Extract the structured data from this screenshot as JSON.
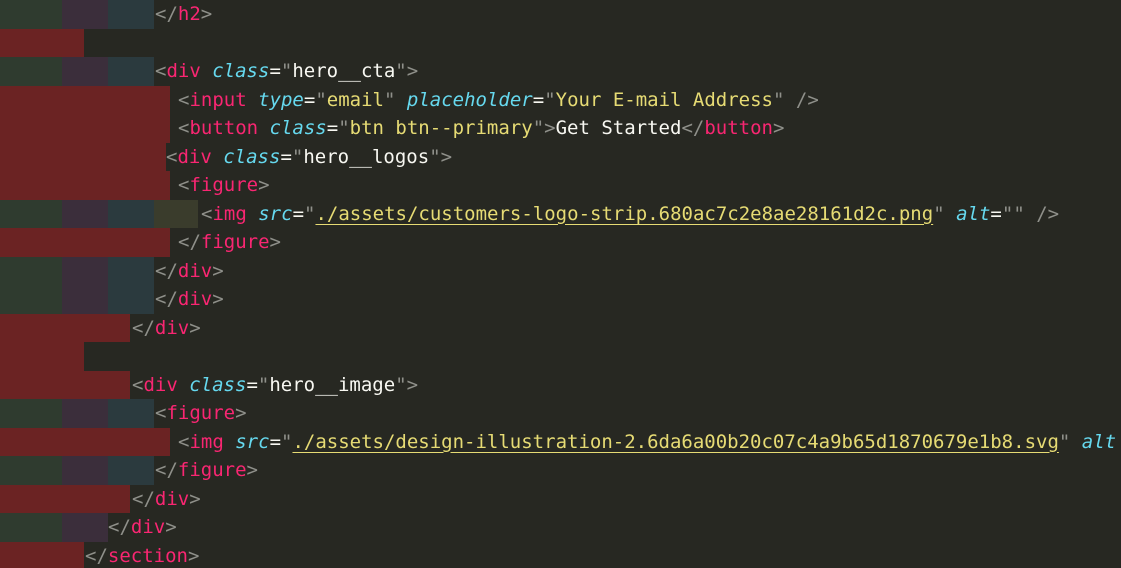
{
  "colors": {
    "background": "#272822",
    "tag": "#f92672",
    "attribute": "#66d9ef",
    "string": "#e6db74",
    "punctuation": "#8f908a",
    "text": "#f8f8f2",
    "indent_red": "#6b2323",
    "indent_green": "#2f3b2f",
    "indent_purple": "#3b2e3b",
    "indent_teal": "#2b3a3e"
  },
  "lines": [
    {
      "tokens": [
        {
          "t": "</",
          "c": "punct"
        },
        {
          "t": "h2",
          "c": "tag"
        },
        {
          "t": ">",
          "c": "punct"
        }
      ]
    },
    {
      "tokens": []
    },
    {
      "tokens": [
        {
          "t": "<",
          "c": "punct"
        },
        {
          "t": "div",
          "c": "tag"
        },
        {
          "t": " ",
          "c": "plain"
        },
        {
          "t": "class",
          "c": "attr"
        },
        {
          "t": "=",
          "c": "eq"
        },
        {
          "t": "\"",
          "c": "punct"
        },
        {
          "t": "hero__cta",
          "c": "plain"
        },
        {
          "t": "\"",
          "c": "punct"
        },
        {
          "t": ">",
          "c": "punct"
        }
      ]
    },
    {
      "tokens": [
        {
          "t": "<",
          "c": "punct"
        },
        {
          "t": "input",
          "c": "tag"
        },
        {
          "t": " ",
          "c": "plain"
        },
        {
          "t": "type",
          "c": "attr"
        },
        {
          "t": "=",
          "c": "eq"
        },
        {
          "t": "\"",
          "c": "punct"
        },
        {
          "t": "email",
          "c": "str"
        },
        {
          "t": "\"",
          "c": "punct"
        },
        {
          "t": " ",
          "c": "plain"
        },
        {
          "t": "placeholder",
          "c": "attr"
        },
        {
          "t": "=",
          "c": "eq"
        },
        {
          "t": "\"",
          "c": "punct"
        },
        {
          "t": "Your E-mail Address",
          "c": "str"
        },
        {
          "t": "\"",
          "c": "punct"
        },
        {
          "t": " />",
          "c": "punct"
        }
      ]
    },
    {
      "tokens": [
        {
          "t": "<",
          "c": "punct"
        },
        {
          "t": "button",
          "c": "tag"
        },
        {
          "t": " ",
          "c": "plain"
        },
        {
          "t": "class",
          "c": "attr"
        },
        {
          "t": "=",
          "c": "eq"
        },
        {
          "t": "\"",
          "c": "punct"
        },
        {
          "t": "btn btn--primary",
          "c": "str"
        },
        {
          "t": "\"",
          "c": "punct"
        },
        {
          "t": ">",
          "c": "punct"
        },
        {
          "t": "Get Started",
          "c": "plain"
        },
        {
          "t": "</",
          "c": "punct"
        },
        {
          "t": "button",
          "c": "tag"
        },
        {
          "t": ">",
          "c": "punct"
        }
      ]
    },
    {
      "tokens": [
        {
          "t": "<",
          "c": "punct"
        },
        {
          "t": "div",
          "c": "tag"
        },
        {
          "t": " ",
          "c": "plain"
        },
        {
          "t": "class",
          "c": "attr"
        },
        {
          "t": "=",
          "c": "eq"
        },
        {
          "t": "\"",
          "c": "punct"
        },
        {
          "t": "hero__logos",
          "c": "plain"
        },
        {
          "t": "\"",
          "c": "punct"
        },
        {
          "t": ">",
          "c": "punct"
        }
      ]
    },
    {
      "tokens": [
        {
          "t": "<",
          "c": "punct"
        },
        {
          "t": "figure",
          "c": "tag"
        },
        {
          "t": ">",
          "c": "punct"
        }
      ]
    },
    {
      "tokens": [
        {
          "t": "<",
          "c": "punct"
        },
        {
          "t": "img",
          "c": "tag"
        },
        {
          "t": " ",
          "c": "plain"
        },
        {
          "t": "src",
          "c": "attr"
        },
        {
          "t": "=",
          "c": "eq"
        },
        {
          "t": "\"",
          "c": "punct"
        },
        {
          "t": "./assets/customers-logo-strip.680ac7c2e8ae28161d2c.png",
          "c": "link"
        },
        {
          "t": "\"",
          "c": "punct"
        },
        {
          "t": " ",
          "c": "plain"
        },
        {
          "t": "alt",
          "c": "attr"
        },
        {
          "t": "=",
          "c": "eq"
        },
        {
          "t": "\"\"",
          "c": "punct"
        },
        {
          "t": " />",
          "c": "punct"
        }
      ]
    },
    {
      "tokens": [
        {
          "t": "</",
          "c": "punct"
        },
        {
          "t": "figure",
          "c": "tag"
        },
        {
          "t": ">",
          "c": "punct"
        }
      ]
    },
    {
      "tokens": [
        {
          "t": "</",
          "c": "punct"
        },
        {
          "t": "div",
          "c": "tag"
        },
        {
          "t": ">",
          "c": "punct"
        }
      ]
    },
    {
      "tokens": [
        {
          "t": "</",
          "c": "punct"
        },
        {
          "t": "div",
          "c": "tag"
        },
        {
          "t": ">",
          "c": "punct"
        }
      ]
    },
    {
      "tokens": [
        {
          "t": "</",
          "c": "punct"
        },
        {
          "t": "div",
          "c": "tag"
        },
        {
          "t": ">",
          "c": "punct"
        }
      ]
    },
    {
      "tokens": []
    },
    {
      "tokens": [
        {
          "t": "<",
          "c": "punct"
        },
        {
          "t": "div",
          "c": "tag"
        },
        {
          "t": " ",
          "c": "plain"
        },
        {
          "t": "class",
          "c": "attr"
        },
        {
          "t": "=",
          "c": "eq"
        },
        {
          "t": "\"",
          "c": "punct"
        },
        {
          "t": "hero__image",
          "c": "plain"
        },
        {
          "t": "\"",
          "c": "punct"
        },
        {
          "t": ">",
          "c": "punct"
        }
      ]
    },
    {
      "tokens": [
        {
          "t": "<",
          "c": "punct"
        },
        {
          "t": "figure",
          "c": "tag"
        },
        {
          "t": ">",
          "c": "punct"
        }
      ]
    },
    {
      "tokens": [
        {
          "t": "<",
          "c": "punct"
        },
        {
          "t": "img",
          "c": "tag"
        },
        {
          "t": " ",
          "c": "plain"
        },
        {
          "t": "src",
          "c": "attr"
        },
        {
          "t": "=",
          "c": "eq"
        },
        {
          "t": "\"",
          "c": "punct"
        },
        {
          "t": "./assets/design-illustration-2.6da6a00b20c07c4a9b65d1870679e1b8.svg",
          "c": "link"
        },
        {
          "t": "\"",
          "c": "punct"
        },
        {
          "t": " ",
          "c": "plain"
        },
        {
          "t": "alt",
          "c": "attr"
        }
      ]
    },
    {
      "tokens": [
        {
          "t": "</",
          "c": "punct"
        },
        {
          "t": "figure",
          "c": "tag"
        },
        {
          "t": ">",
          "c": "punct"
        }
      ]
    },
    {
      "tokens": [
        {
          "t": "</",
          "c": "punct"
        },
        {
          "t": "div",
          "c": "tag"
        },
        {
          "t": ">",
          "c": "punct"
        }
      ]
    },
    {
      "tokens": [
        {
          "t": "</",
          "c": "punct"
        },
        {
          "t": "div",
          "c": "tag"
        },
        {
          "t": ">",
          "c": "punct"
        }
      ]
    },
    {
      "tokens": [
        {
          "t": "</",
          "c": "punct"
        },
        {
          "t": "section",
          "c": "tag"
        },
        {
          "t": ">",
          "c": "punct"
        }
      ]
    }
  ]
}
